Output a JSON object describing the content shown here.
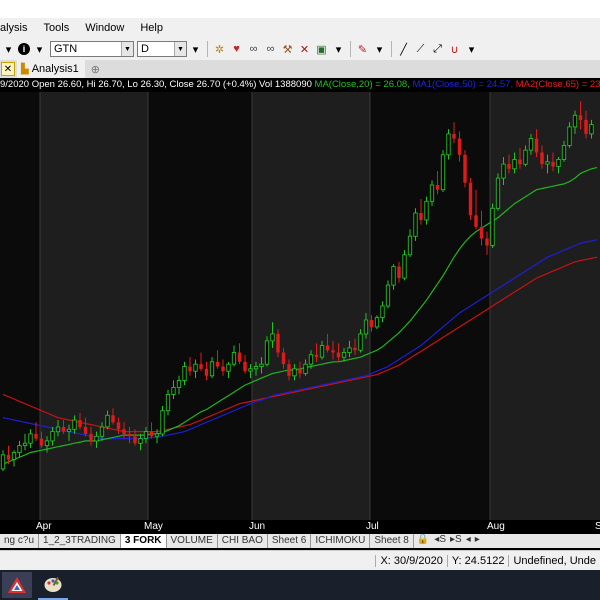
{
  "menu": {
    "items": [
      "alysis",
      "Tools",
      "Window",
      "Help"
    ]
  },
  "toolbar": {
    "symbol": "GTN",
    "interval": "D"
  },
  "tabs": {
    "active": "Analysis1"
  },
  "chart_info": {
    "prefix": "9/2020 Open 26.60, Hi 26.70, Lo 26.30, Close 26.70 (+0.4%) Vol 1388090 ",
    "ma": "MA(Close,20) = 26.08,",
    "ma1": "MA1(Close,50) = 24.57,",
    "ma2": "MA2(Close,65) = 23."
  },
  "colors": {
    "up": "#22c322",
    "down": "#e01a1a",
    "ma": "#1fb51f",
    "ma1": "#1e1ed8",
    "ma2": "#cc1111",
    "panel_dark": "#0b0b0b",
    "panel_light": "#1e1e1e"
  },
  "date_axis": {
    "labels": [
      "Apr",
      "May",
      "Jun",
      "Jul",
      "Aug",
      "S"
    ]
  },
  "sheets": [
    "ng c?u",
    "1_2_3TRADING",
    "3 FORK",
    "VOLUME",
    "CHI BAO",
    "Sheet 6",
    "ICHIMOKU",
    "Sheet 8"
  ],
  "status": {
    "date": "X: 30/9/2020",
    "value": "Y: 24.5122",
    "mode": "Undefined, Unde"
  },
  "chart_data": {
    "type": "candlestick",
    "symbol": "GTN",
    "y_range": [
      12.6,
      31.0
    ],
    "candles": [
      [
        14.8,
        15.6,
        14.7,
        15.4
      ],
      [
        15.4,
        15.8,
        15.0,
        15.2
      ],
      [
        15.2,
        15.6,
        14.9,
        15.5
      ],
      [
        15.5,
        16.0,
        15.3,
        15.8
      ],
      [
        15.8,
        16.3,
        15.6,
        15.9
      ],
      [
        15.9,
        16.5,
        15.7,
        16.3
      ],
      [
        16.3,
        16.8,
        16.0,
        16.1
      ],
      [
        16.1,
        16.4,
        15.7,
        15.8
      ],
      [
        15.8,
        16.2,
        15.5,
        16.0
      ],
      [
        16.0,
        16.6,
        15.8,
        16.4
      ],
      [
        16.4,
        16.9,
        16.2,
        16.6
      ],
      [
        16.6,
        16.9,
        16.3,
        16.4
      ],
      [
        16.4,
        16.7,
        16.0,
        16.5
      ],
      [
        16.5,
        17.1,
        16.3,
        16.9
      ],
      [
        16.9,
        17.2,
        16.5,
        16.6
      ],
      [
        16.6,
        17.0,
        16.2,
        16.3
      ],
      [
        16.3,
        16.6,
        15.8,
        16.0
      ],
      [
        16.0,
        16.4,
        15.7,
        16.2
      ],
      [
        16.2,
        16.8,
        16.0,
        16.6
      ],
      [
        16.6,
        17.3,
        16.5,
        17.1
      ],
      [
        17.1,
        17.4,
        16.7,
        16.8
      ],
      [
        16.8,
        17.0,
        16.3,
        16.5
      ],
      [
        16.5,
        16.8,
        16.1,
        16.3
      ],
      [
        16.3,
        16.6,
        15.9,
        16.2
      ],
      [
        16.2,
        16.5,
        15.8,
        15.9
      ],
      [
        15.9,
        16.3,
        15.6,
        16.1
      ],
      [
        16.1,
        16.6,
        15.9,
        16.4
      ],
      [
        16.4,
        16.8,
        16.1,
        16.2
      ],
      [
        16.2,
        16.5,
        15.9,
        16.3
      ],
      [
        16.3,
        17.5,
        16.2,
        17.3
      ],
      [
        17.3,
        18.2,
        17.1,
        18.0
      ],
      [
        18.0,
        18.6,
        17.8,
        18.3
      ],
      [
        18.3,
        18.8,
        18.0,
        18.6
      ],
      [
        18.6,
        19.4,
        18.4,
        19.2
      ],
      [
        19.2,
        19.6,
        18.8,
        19.0
      ],
      [
        19.0,
        19.5,
        18.7,
        19.3
      ],
      [
        19.3,
        19.8,
        19.0,
        19.1
      ],
      [
        19.1,
        19.4,
        18.6,
        18.8
      ],
      [
        18.8,
        19.6,
        18.7,
        19.4
      ],
      [
        19.4,
        19.9,
        19.1,
        19.2
      ],
      [
        19.2,
        19.5,
        18.8,
        19.0
      ],
      [
        19.0,
        19.4,
        18.7,
        19.3
      ],
      [
        19.3,
        20.1,
        19.2,
        19.8
      ],
      [
        19.8,
        20.2,
        19.3,
        19.4
      ],
      [
        19.4,
        19.7,
        18.9,
        19.0
      ],
      [
        19.0,
        19.3,
        18.7,
        19.1
      ],
      [
        19.1,
        19.4,
        18.8,
        19.2
      ],
      [
        19.2,
        19.6,
        18.9,
        19.3
      ],
      [
        19.3,
        20.5,
        19.2,
        20.3
      ],
      [
        20.3,
        21.1,
        20.0,
        20.6
      ],
      [
        20.6,
        20.8,
        19.6,
        19.8
      ],
      [
        19.8,
        20.0,
        19.1,
        19.3
      ],
      [
        19.3,
        19.5,
        18.6,
        18.8
      ],
      [
        18.8,
        19.3,
        18.6,
        19.1
      ],
      [
        19.1,
        19.4,
        18.7,
        18.9
      ],
      [
        18.9,
        19.5,
        18.8,
        19.3
      ],
      [
        19.3,
        19.9,
        19.1,
        19.7
      ],
      [
        19.7,
        20.2,
        19.4,
        19.6
      ],
      [
        19.6,
        20.3,
        19.5,
        20.1
      ],
      [
        20.1,
        20.6,
        19.8,
        19.9
      ],
      [
        19.9,
        20.3,
        19.5,
        19.8
      ],
      [
        19.8,
        20.2,
        19.4,
        19.6
      ],
      [
        19.6,
        20.0,
        19.4,
        19.8
      ],
      [
        19.8,
        20.3,
        19.6,
        20.0
      ],
      [
        20.0,
        20.4,
        19.7,
        19.9
      ],
      [
        19.9,
        20.8,
        19.8,
        20.6
      ],
      [
        20.6,
        21.5,
        20.4,
        21.2
      ],
      [
        21.2,
        21.4,
        20.7,
        20.9
      ],
      [
        20.9,
        21.4,
        20.8,
        21.3
      ],
      [
        21.3,
        22.0,
        21.1,
        21.8
      ],
      [
        21.8,
        22.9,
        21.7,
        22.7
      ],
      [
        22.7,
        23.6,
        22.5,
        23.5
      ],
      [
        23.5,
        23.7,
        22.8,
        23.0
      ],
      [
        23.0,
        24.2,
        22.9,
        24.0
      ],
      [
        24.0,
        25.1,
        23.9,
        24.8
      ],
      [
        24.8,
        26.0,
        24.6,
        25.8
      ],
      [
        25.8,
        26.4,
        25.3,
        25.5
      ],
      [
        25.5,
        26.5,
        25.3,
        26.3
      ],
      [
        26.3,
        27.2,
        26.1,
        27.0
      ],
      [
        27.0,
        27.6,
        26.6,
        26.8
      ],
      [
        26.8,
        28.5,
        26.7,
        28.3
      ],
      [
        28.3,
        29.4,
        28.1,
        29.2
      ],
      [
        29.2,
        29.7,
        28.8,
        29.0
      ],
      [
        29.0,
        29.3,
        28.0,
        28.3
      ],
      [
        28.3,
        28.5,
        26.9,
        27.1
      ],
      [
        27.1,
        27.3,
        25.5,
        25.7
      ],
      [
        25.7,
        26.8,
        25.1,
        25.2
      ],
      [
        25.2,
        25.9,
        24.4,
        24.7
      ],
      [
        24.7,
        25.0,
        24.0,
        24.4
      ],
      [
        24.4,
        26.2,
        24.3,
        26.0
      ],
      [
        26.0,
        27.5,
        25.9,
        27.3
      ],
      [
        27.3,
        28.2,
        27.0,
        27.9
      ],
      [
        27.9,
        28.3,
        27.5,
        27.7
      ],
      [
        27.7,
        28.4,
        27.5,
        28.1
      ],
      [
        28.1,
        28.6,
        27.7,
        27.9
      ],
      [
        27.9,
        28.7,
        27.8,
        28.5
      ],
      [
        28.5,
        29.2,
        28.3,
        29.0
      ],
      [
        29.0,
        29.4,
        28.2,
        28.4
      ],
      [
        28.4,
        28.7,
        27.7,
        27.9
      ],
      [
        27.9,
        28.3,
        27.5,
        28.0
      ],
      [
        28.0,
        28.4,
        27.6,
        27.8
      ],
      [
        27.8,
        28.2,
        27.5,
        28.1
      ],
      [
        28.1,
        28.9,
        28.0,
        28.7
      ],
      [
        28.7,
        29.7,
        28.6,
        29.5
      ],
      [
        29.5,
        30.2,
        29.2,
        30.0
      ],
      [
        30.0,
        30.6,
        29.4,
        29.8
      ],
      [
        29.8,
        30.2,
        29.0,
        29.2
      ],
      [
        29.2,
        29.8,
        29.0,
        29.6
      ]
    ],
    "ma20": [
      15.0,
      15.1,
      15.2,
      15.3,
      15.4,
      15.5,
      15.55,
      15.6,
      15.65,
      15.7,
      15.75,
      15.8,
      15.85,
      15.9,
      15.95,
      16.0,
      16.0,
      16.0,
      16.05,
      16.1,
      16.15,
      16.2,
      16.25,
      16.25,
      16.25,
      16.25,
      16.25,
      16.3,
      16.3,
      16.35,
      16.45,
      16.55,
      16.65,
      16.8,
      16.95,
      17.1,
      17.25,
      17.35,
      17.5,
      17.65,
      17.8,
      17.95,
      18.1,
      18.25,
      18.4,
      18.5,
      18.6,
      18.7,
      18.8,
      18.9,
      18.95,
      19.0,
      19.05,
      19.05,
      19.1,
      19.15,
      19.2,
      19.25,
      19.3,
      19.35,
      19.4,
      19.4,
      19.45,
      19.5,
      19.55,
      19.6,
      19.7,
      19.8,
      19.9,
      20.05,
      20.25,
      20.45,
      20.65,
      20.9,
      21.15,
      21.45,
      21.75,
      22.05,
      22.4,
      22.75,
      23.1,
      23.5,
      23.9,
      24.25,
      24.55,
      24.8,
      25.0,
      25.15,
      25.3,
      25.45,
      25.6,
      25.8,
      26.0,
      26.2,
      26.35,
      26.5,
      26.65,
      26.8,
      26.85,
      26.9,
      26.95,
      27.0,
      27.05,
      27.15,
      27.3,
      27.5,
      27.6,
      27.7,
      27.75
    ],
    "ma50": [
      17.0,
      16.95,
      16.9,
      16.85,
      16.8,
      16.75,
      16.7,
      16.65,
      16.6,
      16.55,
      16.5,
      16.45,
      16.4,
      16.35,
      16.3,
      16.25,
      16.2,
      16.15,
      16.1,
      16.1,
      16.1,
      16.1,
      16.1,
      16.1,
      16.1,
      16.1,
      16.1,
      16.15,
      16.15,
      16.2,
      16.25,
      16.3,
      16.35,
      16.4,
      16.5,
      16.6,
      16.7,
      16.8,
      16.9,
      17.0,
      17.1,
      17.2,
      17.3,
      17.4,
      17.5,
      17.6,
      17.7,
      17.75,
      17.85,
      17.95,
      18.0,
      18.05,
      18.1,
      18.15,
      18.2,
      18.25,
      18.3,
      18.35,
      18.4,
      18.45,
      18.5,
      18.55,
      18.6,
      18.65,
      18.7,
      18.75,
      18.8,
      18.9,
      19.0,
      19.1,
      19.2,
      19.35,
      19.5,
      19.65,
      19.8,
      19.95,
      20.1,
      20.3,
      20.5,
      20.7,
      20.9,
      21.1,
      21.3,
      21.5,
      21.65,
      21.8,
      21.95,
      22.1,
      22.25,
      22.4,
      22.55,
      22.7,
      22.85,
      23.0,
      23.15,
      23.3,
      23.45,
      23.6,
      23.75,
      23.9,
      24.0,
      24.1,
      24.2,
      24.3,
      24.4,
      24.5,
      24.55,
      24.6,
      24.65
    ],
    "ma65": [
      18.0,
      17.9,
      17.8,
      17.7,
      17.6,
      17.5,
      17.4,
      17.3,
      17.2,
      17.1,
      17.0,
      16.95,
      16.9,
      16.85,
      16.8,
      16.75,
      16.7,
      16.65,
      16.6,
      16.55,
      16.5,
      16.45,
      16.4,
      16.4,
      16.4,
      16.4,
      16.4,
      16.4,
      16.4,
      16.45,
      16.5,
      16.55,
      16.6,
      16.65,
      16.7,
      16.8,
      16.9,
      17.0,
      17.1,
      17.2,
      17.3,
      17.4,
      17.5,
      17.6,
      17.65,
      17.7,
      17.75,
      17.8,
      17.85,
      17.9,
      17.95,
      18.0,
      18.05,
      18.1,
      18.15,
      18.2,
      18.25,
      18.3,
      18.35,
      18.4,
      18.45,
      18.5,
      18.55,
      18.6,
      18.65,
      18.7,
      18.75,
      18.8,
      18.85,
      18.95,
      19.05,
      19.15,
      19.25,
      19.4,
      19.55,
      19.7,
      19.85,
      20.0,
      20.15,
      20.3,
      20.45,
      20.6,
      20.75,
      20.9,
      21.05,
      21.2,
      21.35,
      21.5,
      21.65,
      21.8,
      21.95,
      22.1,
      22.25,
      22.4,
      22.55,
      22.7,
      22.85,
      23.0,
      23.1,
      23.2,
      23.3,
      23.4,
      23.5,
      23.6,
      23.7,
      23.75,
      23.8,
      23.85,
      23.9
    ]
  }
}
